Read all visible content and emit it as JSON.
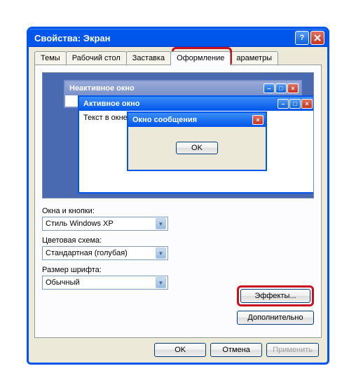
{
  "window": {
    "title": "Свойства: Экран"
  },
  "tabs": {
    "themes": "Темы",
    "desktop": "Рабочий стол",
    "screensaver": "Заставка",
    "appearance": "Оформление",
    "params": "араметры"
  },
  "preview": {
    "inactive_title": "Неактивное окно",
    "active_title": "Активное окно",
    "window_text": "Текст в окне",
    "msgbox_title": "Окно сообщения",
    "msgbox_ok": "OK"
  },
  "fields": {
    "windows_buttons_label": "Окна и кнопки:",
    "windows_buttons_value": "Стиль Windows XP",
    "color_scheme_label": "Цветовая схема:",
    "color_scheme_value": "Стандартная (голубая)",
    "font_size_label": "Размер шрифта:",
    "font_size_value": "Обычный"
  },
  "buttons": {
    "effects": "Эффекты...",
    "advanced": "Дополнительно",
    "ok": "OK",
    "cancel": "Отмена",
    "apply": "Применить"
  }
}
